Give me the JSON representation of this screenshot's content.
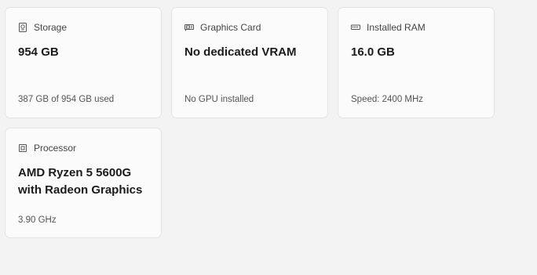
{
  "cards": {
    "storage": {
      "title": "Storage",
      "value": "954 GB",
      "detail": "387 GB of 954 GB used",
      "icon": "storage-icon"
    },
    "graphics": {
      "title": "Graphics Card",
      "value": "No dedicated VRAM",
      "detail": "No GPU installed",
      "icon": "graphics-card-icon"
    },
    "ram": {
      "title": "Installed RAM",
      "value": "16.0 GB",
      "detail": "Speed: 2400 MHz",
      "icon": "ram-icon"
    },
    "processor": {
      "title": "Processor",
      "value": "AMD Ryzen 5 5600G with Radeon Graphics",
      "detail": "3.90 GHz",
      "icon": "processor-icon"
    }
  }
}
